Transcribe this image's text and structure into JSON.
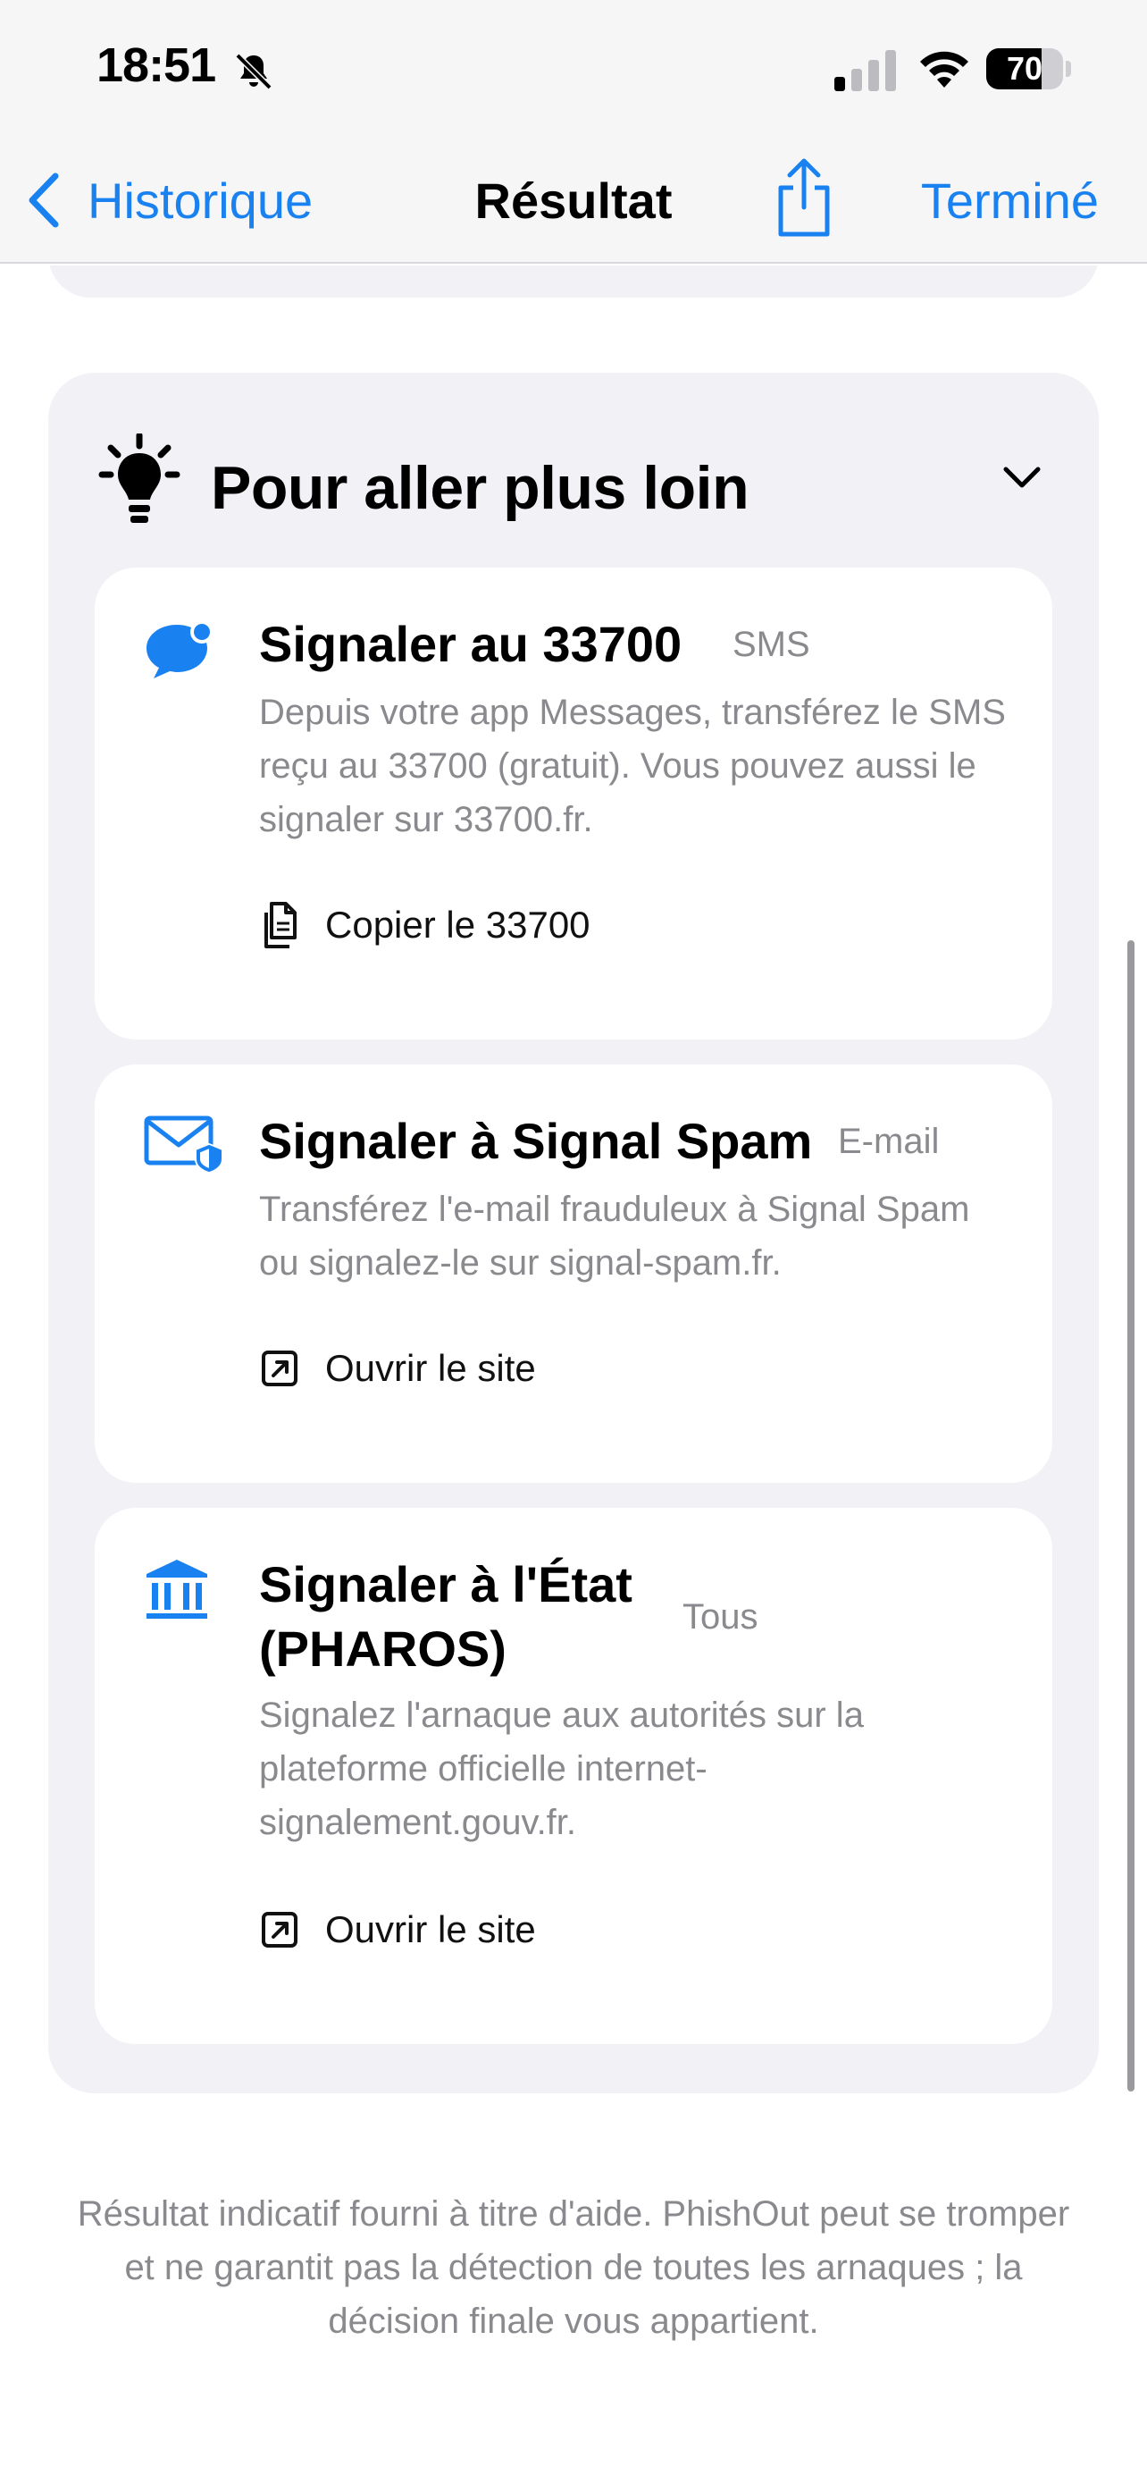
{
  "status_bar": {
    "time": "18:51",
    "battery": "70",
    "battery_level": 0.7,
    "icons": [
      "bell-slash-icon",
      "cellular-signal-icon",
      "wifi-icon",
      "battery-icon"
    ]
  },
  "nav": {
    "back_label": "Historique",
    "title": "Résultat",
    "done_label": "Terminé",
    "accent": "#1a82f0"
  },
  "section": {
    "title": "Pour aller plus loin",
    "cards": [
      {
        "icon": "message-bubble-icon",
        "title": "Signaler au 33700",
        "tag": "SMS",
        "description": "Depuis votre app Messages, transférez le SMS reçu au 33700 (gratuit). Vous pouvez aussi le signaler sur 33700.fr.",
        "action": "Copier le 33700",
        "action_icon": "copy-icon"
      },
      {
        "icon": "envelope-shield-icon",
        "title": "Signaler à Signal Spam",
        "tag": "E-mail",
        "description": "Transférez l'e-mail frauduleux à Signal Spam ou signalez-le sur signal-spam.fr.",
        "action": "Ouvrir le site",
        "action_icon": "external-link-icon"
      },
      {
        "icon": "government-building-icon",
        "title": "Signaler à l'État (PHAROS)",
        "tag": "Tous",
        "description": "Signalez l'arnaque aux autorités sur la plateforme officielle internet-signalement.gouv.fr.",
        "action": "Ouvrir le site",
        "action_icon": "external-link-icon"
      }
    ]
  },
  "footer": "Résultat indicatif fourni à titre d'aide. PhishOut peut se tromper et ne garantit pas la détection de toutes les arnaques ; la décision finale vous appartient."
}
